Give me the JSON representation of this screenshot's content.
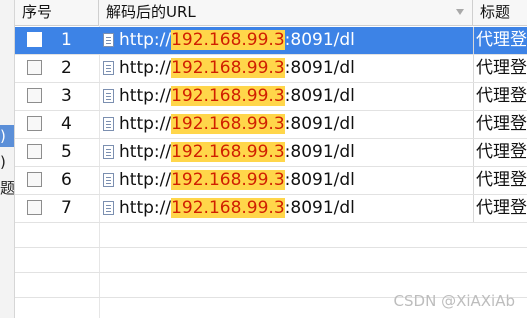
{
  "columns": {
    "index": "序号",
    "decoded_url": "解码后的URL",
    "title": "标题"
  },
  "rows": [
    {
      "index": "1",
      "url_prefix": "http://",
      "host": "192.168.99.3",
      "url_suffix": ":8091/dl",
      "title": "代理登",
      "selected": true
    },
    {
      "index": "2",
      "url_prefix": "http://",
      "host": "192.168.99.3",
      "url_suffix": ":8091/dl",
      "title": "代理登"
    },
    {
      "index": "3",
      "url_prefix": "http://",
      "host": "192.168.99.3",
      "url_suffix": ":8091/dl",
      "title": "代理登"
    },
    {
      "index": "4",
      "url_prefix": "http://",
      "host": "192.168.99.3",
      "url_suffix": ":8091/dl",
      "title": "代理登"
    },
    {
      "index": "5",
      "url_prefix": "http://",
      "host": "192.168.99.3",
      "url_suffix": ":8091/dl",
      "title": "代理登"
    },
    {
      "index": "6",
      "url_prefix": "http://",
      "host": "192.168.99.3",
      "url_suffix": ":8091/dl",
      "title": "代理登"
    },
    {
      "index": "7",
      "url_prefix": "http://",
      "host": "192.168.99.3",
      "url_suffix": ":8091/dl",
      "title": "代理登"
    }
  ],
  "left_fragments": [
    ")",
    ")",
    "题"
  ],
  "watermark": "CSDN @XiAXiAb",
  "colors": {
    "selection": "#3d83e6",
    "highlight": "#ffd64a",
    "highlight_text": "#d01f00"
  },
  "icons": {
    "sort": "sort-indicator-icon",
    "file": "file-icon",
    "checkbox": "checkbox"
  }
}
